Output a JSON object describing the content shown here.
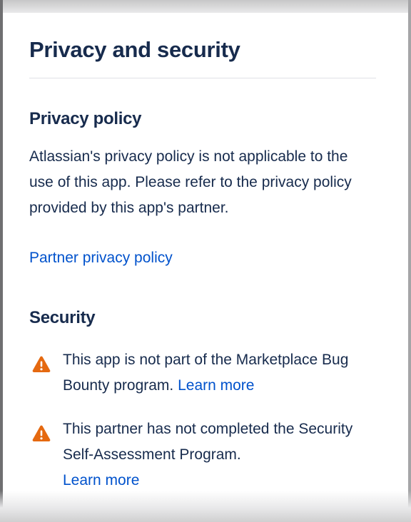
{
  "page": {
    "title": "Privacy and security"
  },
  "privacy": {
    "heading": "Privacy policy",
    "text": "Atlassian's privacy policy is not applicable to the use of this app. Please refer to the privacy policy provided by this app's partner.",
    "link_label": "Partner privacy policy"
  },
  "security": {
    "heading": "Security",
    "items": [
      {
        "icon": "warning-icon",
        "text": "This app is not part of the Marketplace Bug Bounty program.",
        "link_label": "Learn more"
      },
      {
        "icon": "warning-icon",
        "text": "This partner has not completed the Security Self-Assessment Program.",
        "link_label": "Learn more"
      }
    ]
  },
  "colors": {
    "heading": "#172b4d",
    "link": "#0052cc",
    "warning": "#e56910",
    "divider": "#dfe1e6"
  }
}
